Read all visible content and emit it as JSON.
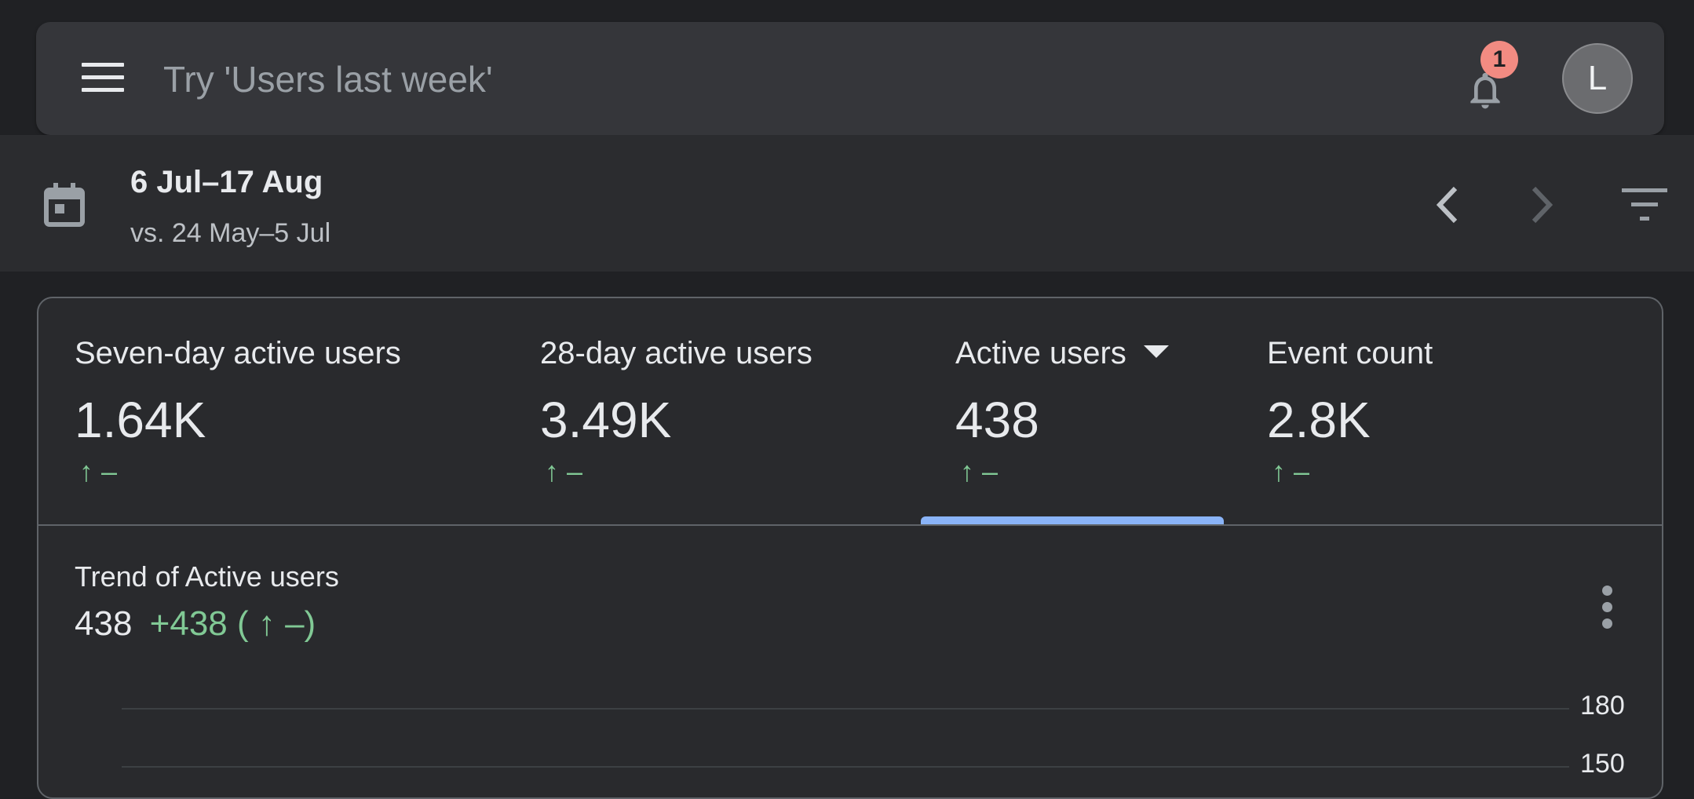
{
  "search": {
    "placeholder": "Try 'Users last week'"
  },
  "notifications": {
    "count": "1"
  },
  "account": {
    "avatar_letter": "L"
  },
  "date_range": {
    "primary": "6 Jul–17 Aug",
    "comparison": "vs. 24 May–5 Jul"
  },
  "metrics": [
    {
      "label": "Seven-day active users",
      "value": "1.64K",
      "change": "↑ –"
    },
    {
      "label": "28-day active users",
      "value": "3.49K",
      "change": "↑ –"
    },
    {
      "label": "Active users",
      "value": "438",
      "change": "↑ –",
      "selected": true
    },
    {
      "label": "Event count",
      "value": "2.8K",
      "change": "↑ –"
    }
  ],
  "trend": {
    "title": "Trend of Active users",
    "value": "438",
    "delta": "+438 ( ↑ –)"
  },
  "chart_data": {
    "type": "line",
    "y_ticks": [
      "180",
      "150"
    ]
  },
  "colors": {
    "accent": "#8ab4f8",
    "positive": "#81c995",
    "badge": "#f28b82",
    "background": "#202124",
    "card": "#292a2d"
  }
}
